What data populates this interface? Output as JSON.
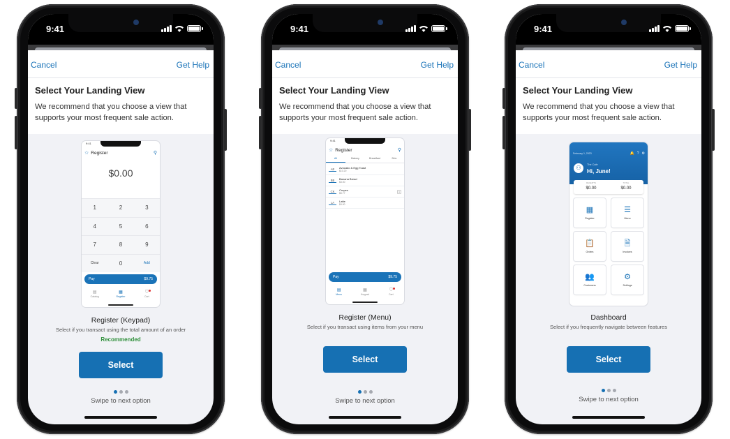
{
  "status": {
    "time": "9:41"
  },
  "nav": {
    "cancel": "Cancel",
    "help": "Get Help"
  },
  "header": {
    "title": "Select Your Landing View",
    "description": "We recommend that you choose a view that supports your most frequent sale action."
  },
  "common": {
    "select_label": "Select",
    "swipe_hint": "Swipe to next option"
  },
  "options": [
    {
      "title": "Register (Keypad)",
      "subtitle": "Select if you transact using the total amount of an order",
      "badge": "Recommended",
      "active_dot": 0,
      "preview": {
        "time": "9:41",
        "screen_title": "Register",
        "amount": "$0.00",
        "keys": [
          [
            "1",
            "2",
            "3"
          ],
          [
            "4",
            "5",
            "6"
          ],
          [
            "7",
            "8",
            "9"
          ],
          [
            "Clear",
            "0",
            "Add"
          ]
        ],
        "pay_label": "Pay",
        "pay_amount": "$9.75",
        "tabs": [
          "Catalog",
          "Register",
          "Cart"
        ]
      }
    },
    {
      "title": "Register (Menu)",
      "subtitle": "Select if you transact using items from your menu",
      "active_dot": 0,
      "preview": {
        "time": "9:41",
        "screen_title": "Register",
        "categories": [
          "All",
          "Bakery",
          "Breakfast",
          "Drin"
        ],
        "items": [
          {
            "abbr": "AE",
            "name": "Avocado & Egg Toast",
            "price": "$10.20"
          },
          {
            "abbr": "BB",
            "name": "Banana Bread",
            "price": "$3.00"
          },
          {
            "abbr": "CK",
            "name": "Crepes",
            "price": "$8.77",
            "qty": "1"
          },
          {
            "abbr": "LA",
            "name": "Latte",
            "price": "$4.00"
          }
        ],
        "pay_label": "Pay",
        "pay_amount": "$9.75",
        "tabs": [
          "Menu",
          "Keypad",
          "Cart"
        ]
      }
    },
    {
      "title": "Dashboard",
      "subtitle": "Select if you frequently navigate between features",
      "active_dot": 0,
      "preview": {
        "date": "February 1, 2023",
        "business": "The Cafe",
        "greeting": "Hi, June!",
        "stats": [
          {
            "label": "RECEIPTS",
            "value": "$0.00"
          },
          {
            "label": "TOTAL",
            "value": "$0.00"
          }
        ],
        "tiles": [
          {
            "label": "Register",
            "icon": "grid-icon"
          },
          {
            "label": "Menu",
            "icon": "list-icon"
          },
          {
            "label": "Orders",
            "icon": "clipboard-icon"
          },
          {
            "label": "Invoices",
            "icon": "invoice-icon"
          },
          {
            "label": "Customers",
            "icon": "people-icon"
          },
          {
            "label": "Settings",
            "icon": "gear-icon"
          }
        ]
      }
    }
  ]
}
